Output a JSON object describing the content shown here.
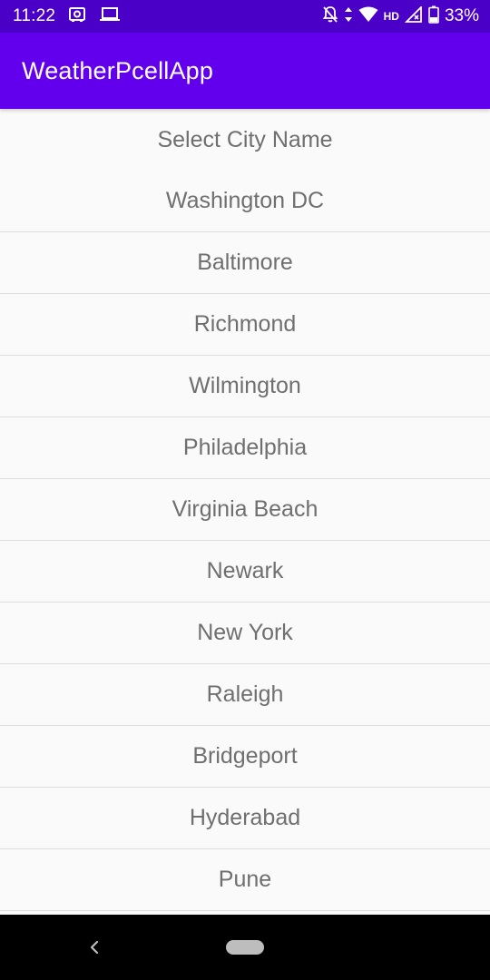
{
  "status_bar": {
    "time": "11:22",
    "hd": "HD",
    "battery": "33%",
    "background": "#4b00c8",
    "left_icons": [
      "storage-icon",
      "laptop-icon"
    ],
    "right_icons": [
      "notifications-off-icon",
      "data-arrows-icon",
      "wifi-icon",
      "cellular-signal-icon",
      "battery-icon"
    ]
  },
  "app_bar": {
    "title": "WeatherPcellApp",
    "background": "#6200ee"
  },
  "spinner": {
    "selected": "Select City Name"
  },
  "cities": [
    "Washington DC",
    "Baltimore",
    "Richmond",
    "Wilmington",
    "Philadelphia",
    "Virginia Beach",
    "Newark",
    "New York",
    "Raleigh",
    "Bridgeport",
    "Hyderabad",
    "Pune"
  ],
  "nav_bar": {
    "icons": [
      "back-icon",
      "home-pill-icon"
    ]
  }
}
